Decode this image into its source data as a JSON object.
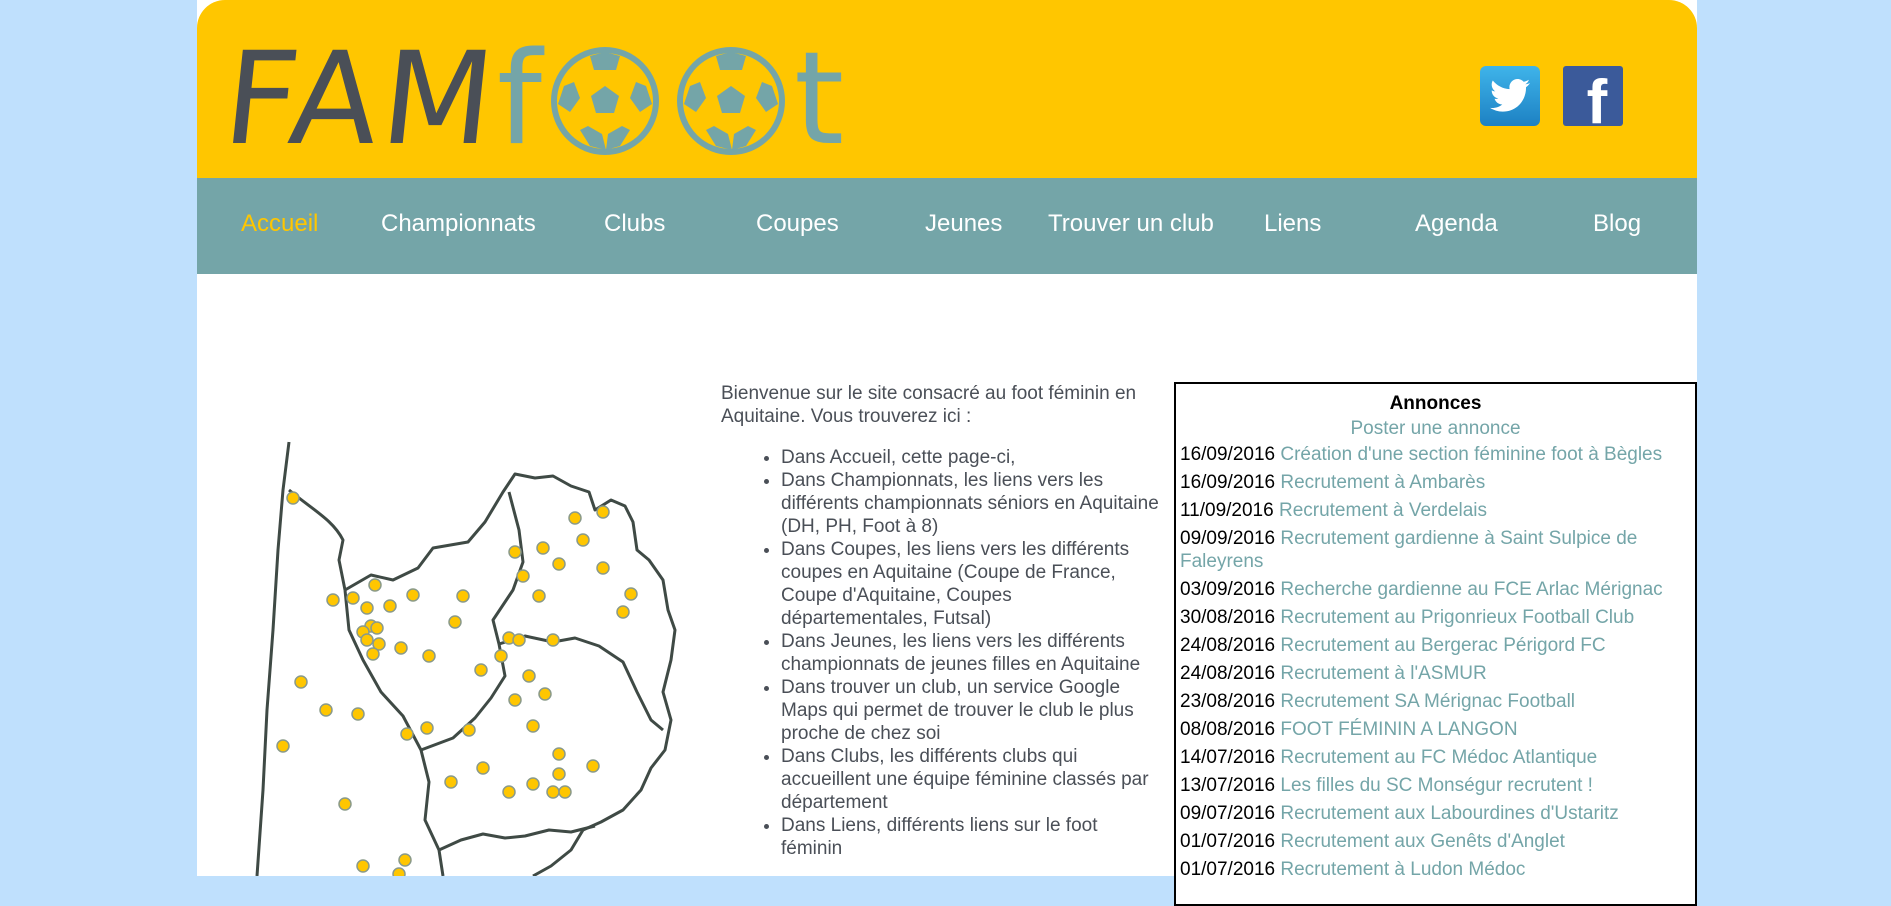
{
  "brand": {
    "logo_text": "FAMfoot"
  },
  "social": {
    "twitter_icon": "twitter-icon",
    "facebook_icon": "facebook-icon"
  },
  "colors": {
    "accent": "#ffc600",
    "teal": "#74a5a8",
    "dark": "#4a4f57",
    "background": "#bfe0fd"
  },
  "nav": {
    "items": [
      {
        "label": "Accueil",
        "active": true
      },
      {
        "label": "Championnats"
      },
      {
        "label": "Clubs"
      },
      {
        "label": "Coupes"
      },
      {
        "label": "Jeunes"
      },
      {
        "label": "Trouver un club"
      },
      {
        "label": "Liens"
      },
      {
        "label": "Agenda"
      },
      {
        "label": "Blog"
      }
    ]
  },
  "intro": {
    "paragraph": "Bienvenue sur le site consacré au foot féminin en Aquitaine. Vous trouverez ici :",
    "items": [
      "Dans Accueil, cette page-ci,",
      "Dans Championnats, les liens vers les différents championnats séniors en Aquitaine (DH, PH, Foot à 8)",
      "Dans Coupes, les liens vers les différents coupes en Aquitaine (Coupe de France, Coupe d'Aquitaine, Coupes départementales, Futsal)",
      "Dans Jeunes, les liens vers les différents championnats de jeunes filles en Aquitaine",
      "Dans trouver un club, un service Google Maps qui permet de trouver le club le plus proche de chez soi",
      "Dans Clubs, les différents clubs qui accueillent une équipe féminine classés par département",
      "Dans Liens, différents liens sur le foot féminin"
    ]
  },
  "annonces": {
    "title": "Annonces",
    "post_link": "Poster une annonce",
    "items": [
      {
        "date": "16/09/2016",
        "title": "Création d'une section féminine foot à Bègles"
      },
      {
        "date": "16/09/2016",
        "title": "Recrutement à Ambarès"
      },
      {
        "date": "11/09/2016",
        "title": "Recrutement à Verdelais"
      },
      {
        "date": "09/09/2016",
        "title": "Recrutement gardienne à Saint Sulpice de Faleyrens"
      },
      {
        "date": "03/09/2016",
        "title": "Recherche gardienne au FCE Arlac Mérignac"
      },
      {
        "date": "30/08/2016",
        "title": "Recrutement au Prigonrieux Football Club"
      },
      {
        "date": "24/08/2016",
        "title": "Recrutement au Bergerac Périgord FC"
      },
      {
        "date": "24/08/2016",
        "title": "Recrutement à l'ASMUR"
      },
      {
        "date": "23/08/2016",
        "title": "Recrutement SA Mérignac Football"
      },
      {
        "date": "08/08/2016",
        "title": "FOOT FÉMININ A LANGON"
      },
      {
        "date": "14/07/2016",
        "title": "Recrutement au FC Médoc Atlantique"
      },
      {
        "date": "13/07/2016",
        "title": "Les filles du SC Monségur recrutent !"
      },
      {
        "date": "09/07/2016",
        "title": "Recrutement aux Labourdines d'Ustaritz"
      },
      {
        "date": "01/07/2016",
        "title": "Recrutement aux Genêts d'Anglet"
      },
      {
        "date": "01/07/2016",
        "title": "Recrutement à Ludon Médoc"
      }
    ]
  }
}
